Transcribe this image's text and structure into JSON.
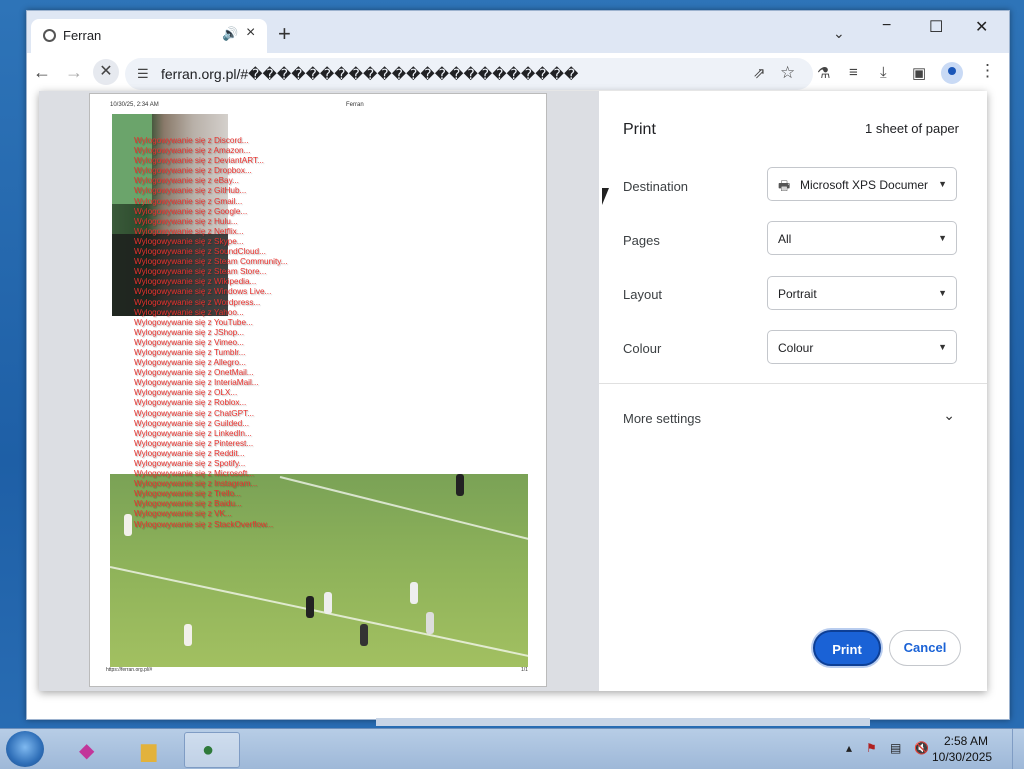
{
  "browser": {
    "tab_title": "Ferran",
    "tab_close": "×",
    "new_tab": "+",
    "url": "ferran.org.pl/#�����������������������",
    "window_controls": {
      "minimize": "−",
      "maximize": "☐",
      "close": "✕"
    }
  },
  "print_preview": {
    "header_date": "10/30/25, 2:34 AM",
    "header_title": "Ferran",
    "footer_url": "https://ferran.org.pl/#",
    "footer_page": "1/1",
    "messages": [
      "Wylogowywanie się z Discord...",
      "Wylogowywanie się z Amazon...",
      "Wylogowywanie się z DeviantART...",
      "Wylogowywanie się z Dropbox...",
      "Wylogowywanie się z eBay...",
      "Wylogowywanie się z GitHub...",
      "Wylogowywanie się z Gmail...",
      "Wylogowywanie się z Google...",
      "Wylogowywanie się z Hulu...",
      "Wylogowywanie się z Netflix...",
      "Wylogowywanie się z Skype...",
      "Wylogowywanie się z SoundCloud...",
      "Wylogowywanie się z Steam Community...",
      "Wylogowywanie się z Steam Store...",
      "Wylogowywanie się z Wikipedia...",
      "Wylogowywanie się z Windows Live...",
      "Wylogowywanie się z Wordpress...",
      "Wylogowywanie się z Yahoo...",
      "Wylogowywanie się z YouTube...",
      "Wylogowywanie się z JShop...",
      "Wylogowywanie się z Vimeo...",
      "Wylogowywanie się z Tumblr...",
      "Wylogowywanie się z Allegro...",
      "Wylogowywanie się z OnetMail...",
      "Wylogowywanie się z InteriaMail...",
      "Wylogowywanie się z OLX...",
      "Wylogowywanie się z Roblox...",
      "Wylogowywanie się z ChatGPT...",
      "Wylogowywanie się z Guilded...",
      "Wylogowywanie się z LinkedIn...",
      "Wylogowywanie się z Pinterest...",
      "Wylogowywanie się z Reddit...",
      "Wylogowywanie się z Spotify...",
      "Wylogowywanie się z Microsoft...",
      "Wylogowywanie się z Instagram...",
      "Wylogowywanie się z Trello...",
      "Wylogowywanie się z Baidu...",
      "Wylogowywanie się z VK...",
      "Wylogowywanie się z StackOverflow..."
    ]
  },
  "print_settings": {
    "title": "Print",
    "sheets": "1 sheet of paper",
    "destination_label": "Destination",
    "destination_value": "Microsoft XPS Documer",
    "pages_label": "Pages",
    "pages_value": "All",
    "layout_label": "Layout",
    "layout_value": "Portrait",
    "colour_label": "Colour",
    "colour_value": "Colour",
    "more_settings": "More settings",
    "print_button": "Print",
    "cancel_button": "Cancel"
  },
  "taskbar": {
    "time": "2:58 AM",
    "date": "10/30/2025"
  },
  "colors": {
    "accent": "#1a62d6",
    "message_text": "#e8322e"
  }
}
